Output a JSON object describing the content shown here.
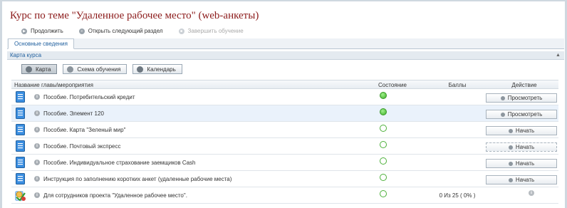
{
  "title": "Курс по теме \"Удаленное рабочее место\" (web-анкеты)",
  "toolbar": {
    "continue": "Продолжить",
    "open_next": "Открыть следующий раздел",
    "finish": "Завершить обучение"
  },
  "tabs": {
    "main": "Основные сведения"
  },
  "panel": {
    "title": "Карта курса"
  },
  "views": {
    "map": "Карта",
    "scheme": "Схема обучения",
    "calendar": "Календарь"
  },
  "columns": {
    "name": "Название главы\\мероприятия",
    "state": "Состояние",
    "score": "Баллы",
    "action": "Действие"
  },
  "rows": [
    {
      "name": "Пособие. Потребительский кредит",
      "state": "completed",
      "score": "",
      "action": "Просмотреть"
    },
    {
      "name": "Пособие. Элемент 120",
      "state": "completed",
      "score": "",
      "action": "Просмотреть"
    },
    {
      "name": "Пособие. Карта \"Зеленый мир\"",
      "state": "not-started",
      "score": "",
      "action": "Начать"
    },
    {
      "name": "Пособие. Почтовый экспресс",
      "state": "not-started",
      "score": "",
      "action": "Начать"
    },
    {
      "name": "Пособие. Индивидуальное страхование заемщиков Cash",
      "state": "not-started",
      "score": "",
      "action": "Начать"
    },
    {
      "name": "Инструкция по заполнению коротких анкет (удаленные рабочие места)",
      "state": "not-started",
      "score": "",
      "action": "Начать"
    },
    {
      "name": "Для сотрудников проекта \"Удаленное рабочее место\".",
      "state": "not-started",
      "score": "0 Из 25 ( 0% )",
      "action": ""
    }
  ],
  "icons": {
    "document": "document-icon",
    "info": "info-icon",
    "group": "test-group-icon",
    "play": "play-icon"
  },
  "colors": {
    "title": "#8b1a1a",
    "link": "#1f5f9e",
    "status_done": "#3fae2a",
    "selected_row": "#eaf2fb"
  }
}
